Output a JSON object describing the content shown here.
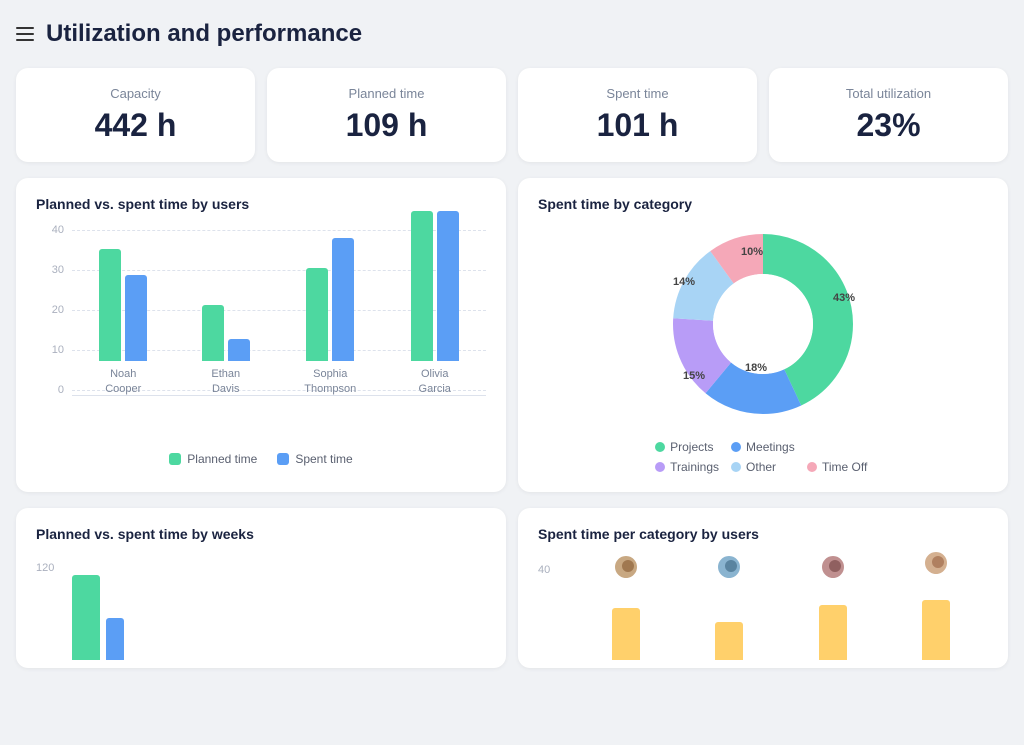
{
  "header": {
    "title": "Utilization and performance",
    "menu_icon": "hamburger-icon"
  },
  "metrics": [
    {
      "label": "Capacity",
      "value": "442 h"
    },
    {
      "label": "Planned time",
      "value": "109 h"
    },
    {
      "label": "Spent time",
      "value": "101 h"
    },
    {
      "label": "Total utilization",
      "value": "23%"
    }
  ],
  "bar_chart": {
    "title": "Planned vs. spent time by users",
    "y_labels": [
      "40",
      "30",
      "20",
      "10",
      "0"
    ],
    "groups": [
      {
        "name": "Noah\nCooper",
        "planned": 30,
        "spent": 23
      },
      {
        "name": "Ethan\nDavis",
        "planned": 15,
        "spent": 6
      },
      {
        "name": "Sophia\nThompson",
        "planned": 25,
        "spent": 33
      },
      {
        "name": "Olivia\nGarcia",
        "planned": 40,
        "spent": 40
      }
    ],
    "max": 40,
    "legend": {
      "planned": "Planned time",
      "spent": "Spent time"
    }
  },
  "donut_chart": {
    "title": "Spent time by category",
    "segments": [
      {
        "label": "Projects",
        "pct": 43,
        "color": "#4dd8a0"
      },
      {
        "label": "Meetings",
        "pct": 18,
        "color": "#5b9ef5"
      },
      {
        "label": "Trainings",
        "pct": 15,
        "color": "#b89cf7"
      },
      {
        "label": "Other",
        "pct": 14,
        "color": "#a8d4f5"
      },
      {
        "label": "Time Off",
        "pct": 10,
        "color": "#f5a8b8"
      }
    ]
  },
  "weekly_chart": {
    "title": "Planned vs. spent time by weeks",
    "y_label": "120"
  },
  "user_category_chart": {
    "title": "Spent time per category by users",
    "y_label": "40"
  }
}
